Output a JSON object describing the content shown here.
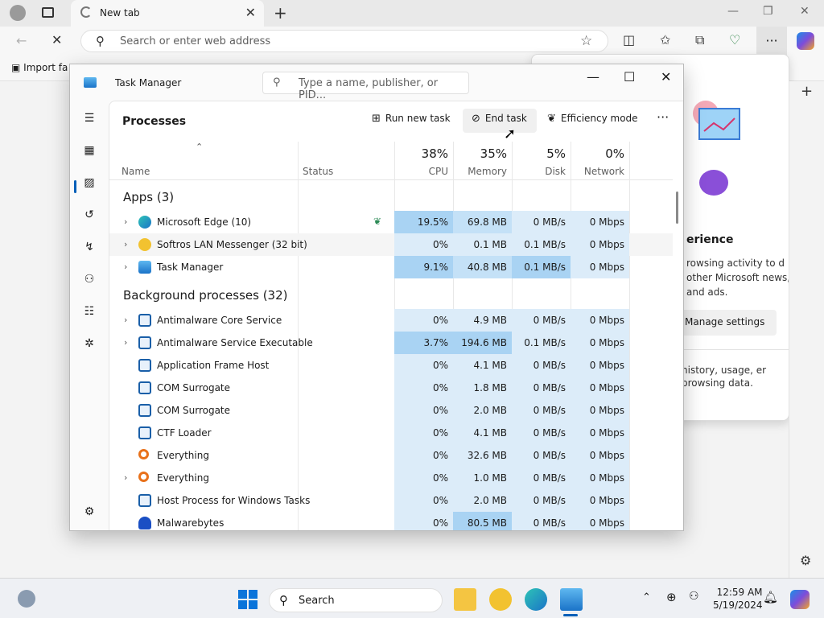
{
  "browser": {
    "tab_title": "New tab",
    "address_placeholder": "Search or enter web address",
    "favorites_item": "Import fa",
    "panel": {
      "title": "erience",
      "text": "rowsing activity to d other Microsoft news, and ads.",
      "button": "Manage settings",
      "text2": "history, usage, er browsing data."
    }
  },
  "task_manager": {
    "title": "Task Manager",
    "search_placeholder": "Type a name, publisher, or PID...",
    "page_title": "Processes",
    "commands": {
      "run_new_task": "Run new task",
      "end_task": "End task",
      "efficiency_mode": "Efficiency mode"
    },
    "columns": {
      "name": "Name",
      "status": "Status",
      "cpu_pct": "38%",
      "cpu": "CPU",
      "memory_pct": "35%",
      "memory": "Memory",
      "disk_pct": "5%",
      "disk": "Disk",
      "network_pct": "0%",
      "network": "Network"
    },
    "groups": {
      "apps": "Apps (3)",
      "background": "Background processes (32)"
    },
    "apps": [
      {
        "name": "Microsoft Edge (10)",
        "cpu": "19.5%",
        "memory": "69.8 MB",
        "disk": "0 MB/s",
        "network": "0 Mbps"
      },
      {
        "name": "Softros LAN Messenger (32 bit)",
        "cpu": "0%",
        "memory": "0.1 MB",
        "disk": "0.1 MB/s",
        "network": "0 Mbps"
      },
      {
        "name": "Task Manager",
        "cpu": "9.1%",
        "memory": "40.8 MB",
        "disk": "0.1 MB/s",
        "network": "0 Mbps"
      }
    ],
    "background": [
      {
        "name": "Antimalware Core Service",
        "cpu": "0%",
        "memory": "4.9 MB",
        "disk": "0 MB/s",
        "network": "0 Mbps"
      },
      {
        "name": "Antimalware Service Executable",
        "cpu": "3.7%",
        "memory": "194.6 MB",
        "disk": "0.1 MB/s",
        "network": "0 Mbps"
      },
      {
        "name": "Application Frame Host",
        "cpu": "0%",
        "memory": "4.1 MB",
        "disk": "0 MB/s",
        "network": "0 Mbps"
      },
      {
        "name": "COM Surrogate",
        "cpu": "0%",
        "memory": "1.8 MB",
        "disk": "0 MB/s",
        "network": "0 Mbps"
      },
      {
        "name": "COM Surrogate",
        "cpu": "0%",
        "memory": "2.0 MB",
        "disk": "0 MB/s",
        "network": "0 Mbps"
      },
      {
        "name": "CTF Loader",
        "cpu": "0%",
        "memory": "4.1 MB",
        "disk": "0 MB/s",
        "network": "0 Mbps"
      },
      {
        "name": "Everything",
        "cpu": "0%",
        "memory": "32.6 MB",
        "disk": "0 MB/s",
        "network": "0 Mbps"
      },
      {
        "name": "Everything",
        "cpu": "0%",
        "memory": "1.0 MB",
        "disk": "0 MB/s",
        "network": "0 Mbps"
      },
      {
        "name": "Host Process for Windows Tasks",
        "cpu": "0%",
        "memory": "2.0 MB",
        "disk": "0 MB/s",
        "network": "0 Mbps"
      },
      {
        "name": "Malwarebytes",
        "cpu": "0%",
        "memory": "80.5 MB",
        "disk": "0 MB/s",
        "network": "0 Mbps"
      }
    ]
  },
  "taskbar": {
    "search_label": "Search",
    "time": "12:59 AM",
    "date": "5/19/2024"
  },
  "colors": {
    "heat_light": "#dcecf9",
    "heat_mid": "#c4e1f7",
    "heat_strong": "#a9d3f3",
    "accent": "#005fb8"
  }
}
